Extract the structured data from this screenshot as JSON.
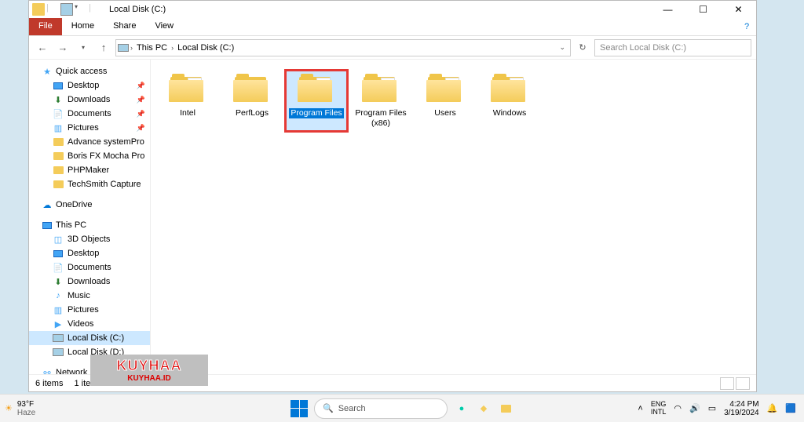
{
  "window": {
    "title": "Local Disk (C:)"
  },
  "ribbon": {
    "file": "File",
    "home": "Home",
    "share": "Share",
    "view": "View"
  },
  "breadcrumb": {
    "seg1": "This PC",
    "seg2": "Local Disk (C:)"
  },
  "search": {
    "placeholder": "Search Local Disk (C:)"
  },
  "sidebar": {
    "quick_access": "Quick access",
    "qa": {
      "desktop": "Desktop",
      "downloads": "Downloads",
      "documents": "Documents",
      "pictures": "Pictures",
      "adv": "Advance systemPro",
      "boris": "Boris FX Mocha Pro",
      "php": "PHPMaker",
      "tech": "TechSmith Capture"
    },
    "onedrive": "OneDrive",
    "this_pc": "This PC",
    "pc": {
      "objects3d": "3D Objects",
      "desktop": "Desktop",
      "documents": "Documents",
      "downloads": "Downloads",
      "music": "Music",
      "pictures": "Pictures",
      "videos": "Videos",
      "diskc": "Local Disk (C:)",
      "diskd": "Local Disk (D:)"
    },
    "network": "Network"
  },
  "folders": {
    "intel": "Intel",
    "perflogs": "PerfLogs",
    "progfiles": "Program Files",
    "progfiles86": "Program Files (x86)",
    "users": "Users",
    "windows": "Windows"
  },
  "status": {
    "count": "6 items",
    "selected": "1 item selected"
  },
  "watermark": {
    "big": "KUYHAA",
    "small": "KUYHAA.ID"
  },
  "taskbar": {
    "temp": "93°F",
    "cond": "Haze",
    "search": "Search",
    "lang1": "ENG",
    "lang2": "INTL",
    "time": "4:24 PM",
    "date": "3/19/2024"
  }
}
